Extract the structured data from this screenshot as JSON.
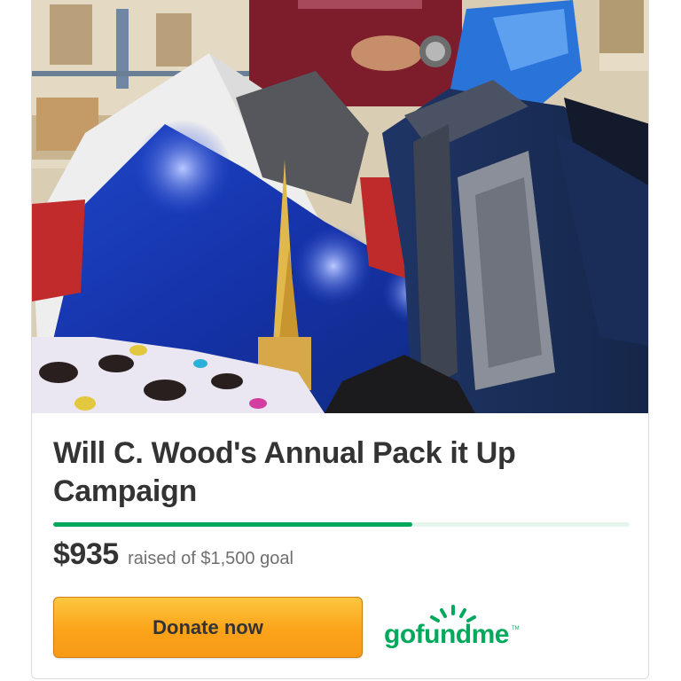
{
  "campaign": {
    "title": "Will C. Wood's Annual Pack it Up Campaign",
    "raised_amount": "$935",
    "raised_text": "raised of $1,500 goal",
    "progress_fraction": 0.623
  },
  "actions": {
    "donate_label": "Donate now"
  },
  "brand": {
    "logo_text": "gofundme",
    "trademark": "TM"
  },
  "colors": {
    "progress": "#02a95c",
    "progress_track": "#e6f4ee",
    "donate_button": "#fba319",
    "brand_green": "#02a95c",
    "title_text": "#333333"
  },
  "icons": {
    "hero": "campaign-photo",
    "logo": "gofundme-logo"
  }
}
